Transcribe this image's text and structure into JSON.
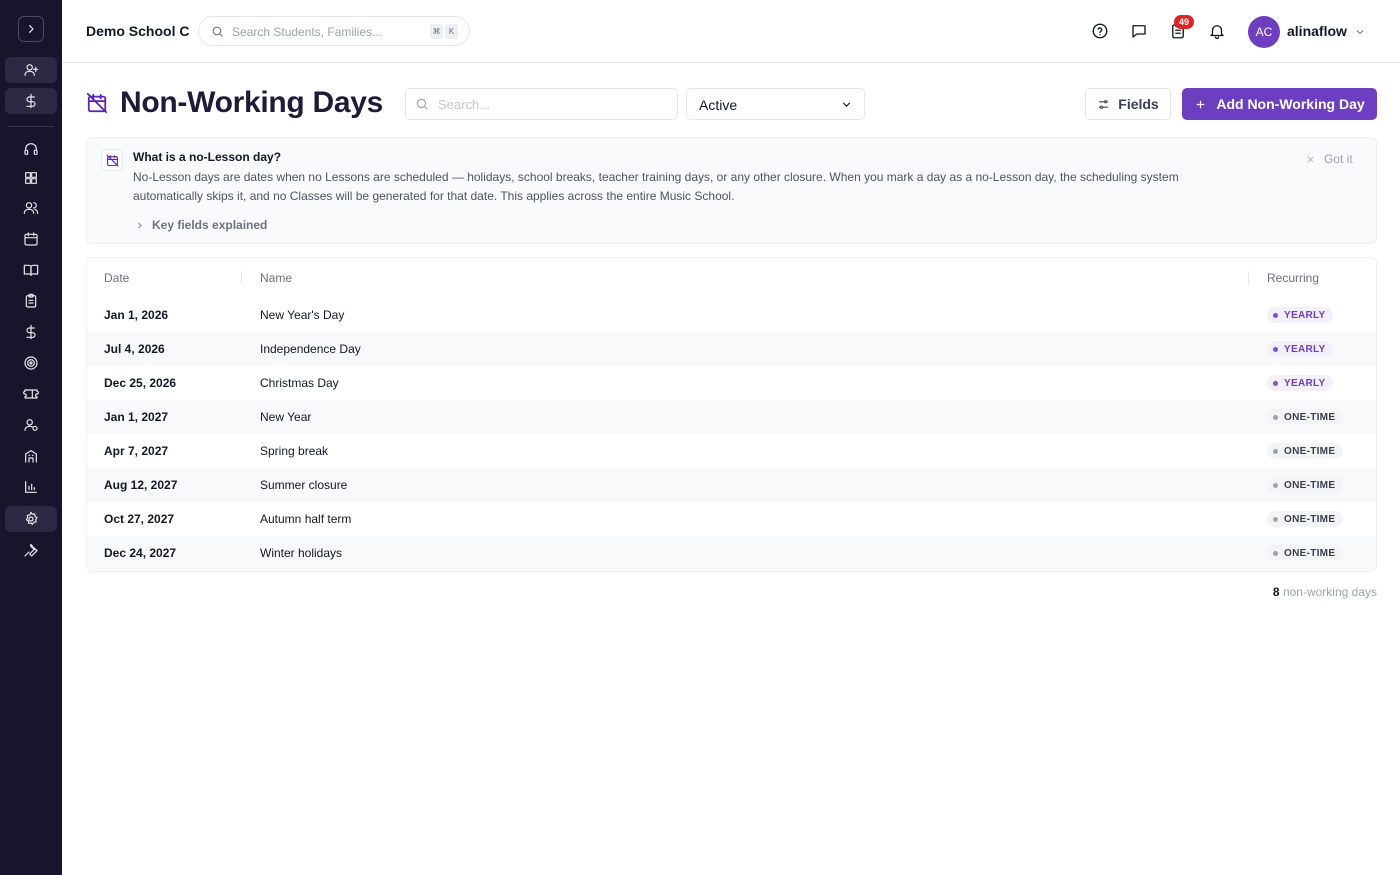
{
  "topbar": {
    "school_name": "Demo School C",
    "search_placeholder": "Search Students, Families...",
    "shortcut_keys": [
      "⌘",
      "K"
    ],
    "tasks_badge": "49",
    "user_initials": "AC",
    "user_name": "alinaflow"
  },
  "sidebar": {
    "items": [
      {
        "icon": "user-plus-icon"
      },
      {
        "icon": "dollar-icon"
      },
      {
        "icon": "headset-icon"
      },
      {
        "icon": "dashboard-icon"
      },
      {
        "icon": "users-icon"
      },
      {
        "icon": "calendar-icon"
      },
      {
        "icon": "book-icon"
      },
      {
        "icon": "clipboard-icon"
      },
      {
        "icon": "dollar-icon"
      },
      {
        "icon": "target-icon"
      },
      {
        "icon": "ticket-icon"
      },
      {
        "icon": "user-settings-icon"
      },
      {
        "icon": "building-icon"
      },
      {
        "icon": "bar-chart-icon"
      },
      {
        "icon": "gear-icon"
      },
      {
        "icon": "wrench-icon"
      }
    ],
    "active_item": "gear-icon"
  },
  "page": {
    "title": "Non-Working Days",
    "search_placeholder": "Search...",
    "status_filter": "Active",
    "fields_label": "Fields",
    "add_label": "Add Non-Working Day"
  },
  "info": {
    "title": "What is a no-Lesson day?",
    "body": "No-Lesson days are dates when no Lessons are scheduled — holidays, school breaks, teacher training days, or any other closure. When you mark a day as a no-Lesson day, the scheduling system automatically skips it, and no Classes will be generated for that date. This applies across the entire Music School.",
    "dismiss_label": "Got it",
    "key_fields_label": "Key fields explained"
  },
  "table": {
    "columns": [
      "Date",
      "Name",
      "Recurring"
    ],
    "rows": [
      {
        "date": "Jan 1, 2026",
        "name": "New Year's Day",
        "recurring": "YEARLY"
      },
      {
        "date": "Jul 4, 2026",
        "name": "Independence Day",
        "recurring": "YEARLY"
      },
      {
        "date": "Dec 25, 2026",
        "name": "Christmas Day",
        "recurring": "YEARLY"
      },
      {
        "date": "Jan 1, 2027",
        "name": "New Year",
        "recurring": "ONE-TIME"
      },
      {
        "date": "Apr 7, 2027",
        "name": "Spring break",
        "recurring": "ONE-TIME"
      },
      {
        "date": "Aug 12, 2027",
        "name": "Summer closure",
        "recurring": "ONE-TIME"
      },
      {
        "date": "Oct 27, 2027",
        "name": "Autumn half term",
        "recurring": "ONE-TIME"
      },
      {
        "date": "Dec 24, 2027",
        "name": "Winter holidays",
        "recurring": "ONE-TIME"
      }
    ]
  },
  "footer": {
    "count": "8",
    "count_label": "non-working days"
  },
  "colors": {
    "accent": "#6d3fc0",
    "sidebar_bg": "#17152b",
    "badge": "#dc2626"
  }
}
